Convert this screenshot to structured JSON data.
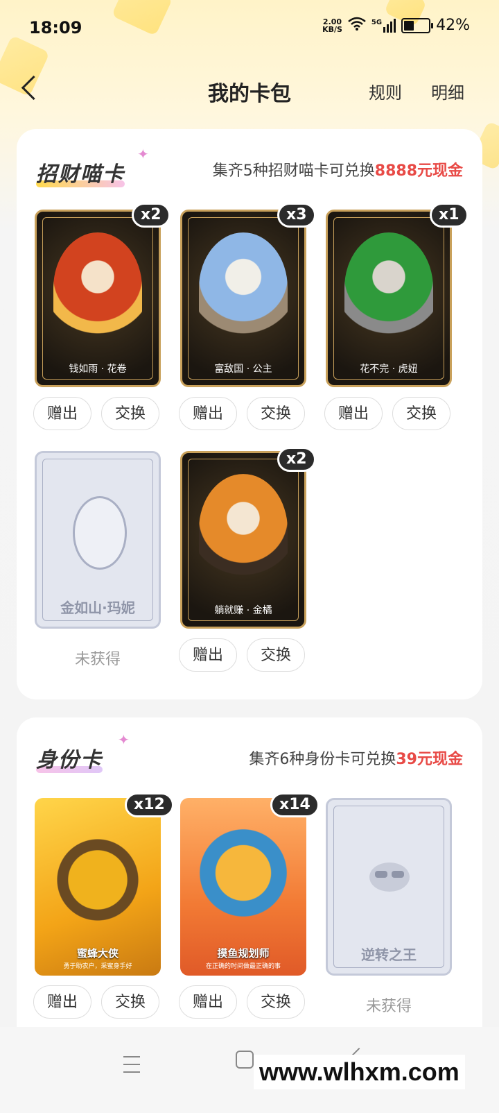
{
  "status": {
    "time": "18:09",
    "speed_value": "2.00",
    "speed_unit": "KB/S",
    "signal_label": "5G",
    "battery": "42%",
    "battery_level": 0.42
  },
  "nav": {
    "title": "我的卡包",
    "rules": "规则",
    "details": "明细"
  },
  "section1": {
    "title": "招财喵卡",
    "desc_prefix": "集齐5种招财喵卡可兑换",
    "desc_highlight": "8888元现金",
    "cards": [
      {
        "name": "钱如雨 · 花卷",
        "count": "x2",
        "gift": "赠出",
        "swap": "交换"
      },
      {
        "name": "富敌国 · 公主",
        "count": "x3",
        "gift": "赠出",
        "swap": "交换"
      },
      {
        "name": "花不完 · 虎妞",
        "count": "x1",
        "gift": "赠出",
        "swap": "交换"
      },
      {
        "name": "金如山·玛妮",
        "status": "未获得"
      },
      {
        "name": "躺就赚 · 金橘",
        "count": "x2",
        "gift": "赠出",
        "swap": "交换"
      }
    ]
  },
  "section2": {
    "title": "身份卡",
    "desc_prefix": "集齐6种身份卡可兑换",
    "desc_highlight": "39元现金",
    "cards": [
      {
        "name": "蜜蜂大侠",
        "sub": "勇于助农户，采蜜身手好",
        "count": "x12",
        "gift": "赠出",
        "swap": "交换"
      },
      {
        "name": "摸鱼规划师",
        "sub": "在正确的时间做最正确的事",
        "count": "x14",
        "gift": "赠出",
        "swap": "交换"
      },
      {
        "name": "逆转之王",
        "status": "未获得"
      }
    ]
  },
  "watermark": "www.wlhxm.com"
}
